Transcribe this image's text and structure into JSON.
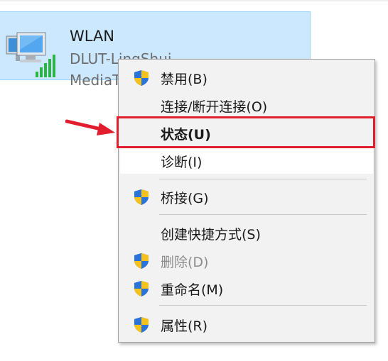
{
  "adapter": {
    "name": "WLAN",
    "network": "DLUT-LingShui",
    "device": "MediaT"
  },
  "menu": {
    "items": [
      {
        "label": "禁用(B)",
        "icon": "uac-shield-icon"
      },
      {
        "label": "连接/断开连接(O)"
      },
      {
        "label": "状态(U)",
        "bold": true
      },
      {
        "label": "诊断(I)",
        "hovered": true
      },
      {
        "label": "桥接(G)",
        "icon": "uac-shield-icon"
      },
      {
        "label": "创建快捷方式(S)"
      },
      {
        "label": "删除(D)",
        "icon": "uac-shield-icon",
        "disabled": true
      },
      {
        "label": "重命名(M)",
        "icon": "uac-shield-icon"
      },
      {
        "label": "属性(R)",
        "icon": "uac-shield-icon"
      }
    ]
  },
  "colors": {
    "selection_bg": "#cce8ff",
    "menu_bg": "#f2f2f2",
    "annotation_red": "#e01e2d"
  }
}
